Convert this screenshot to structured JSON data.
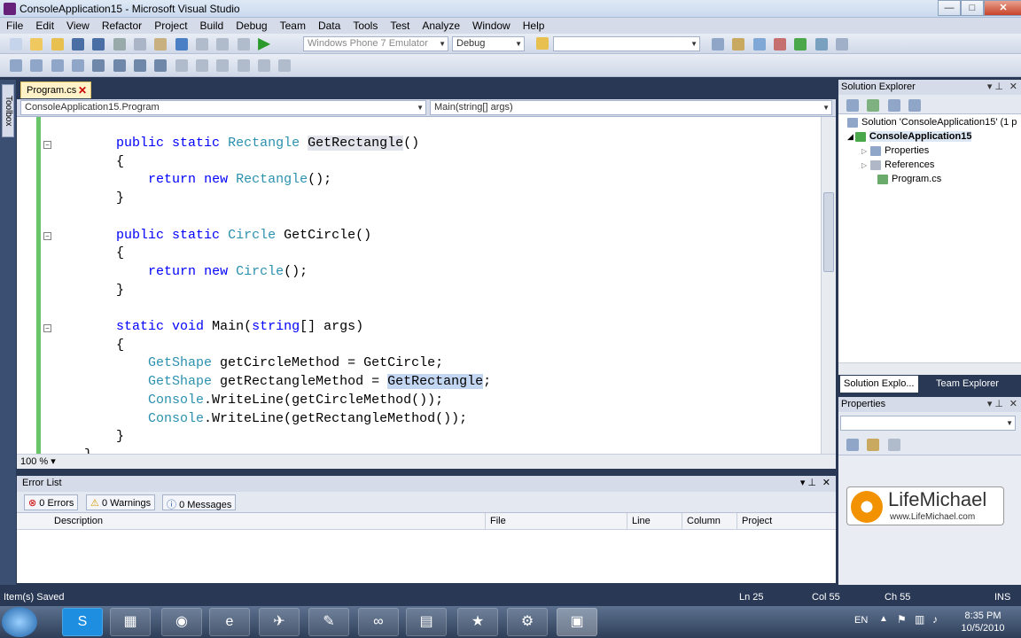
{
  "window": {
    "title": "ConsoleApplication15 - Microsoft Visual Studio",
    "minimize": "—",
    "maximize": "□",
    "close": "✕"
  },
  "menu": [
    "File",
    "Edit",
    "View",
    "Refactor",
    "Project",
    "Build",
    "Debug",
    "Team",
    "Data",
    "Tools",
    "Test",
    "Analyze",
    "Window",
    "Help"
  ],
  "toolbar": {
    "device": "Windows Phone 7 Emulator",
    "config": "Debug",
    "search": ""
  },
  "toolbox": {
    "label": "Toolbox"
  },
  "editor": {
    "tab": "Program.cs",
    "nav_left": "ConsoleApplication15.Program",
    "nav_right": "Main(string[] args)",
    "zoom": "100 %",
    "accent": "#6ac46a",
    "highlight": "#c3d7f3"
  },
  "error_list": {
    "title": "Error List",
    "errors": "0 Errors",
    "warnings": "0 Warnings",
    "messages": "0 Messages",
    "columns": [
      "Description",
      "File",
      "Line",
      "Column",
      "Project"
    ]
  },
  "status": {
    "left": "Item(s) Saved",
    "ln": "Ln 25",
    "col": "Col 55",
    "ch": "Ch 55",
    "ins": "INS"
  },
  "solution_explorer": {
    "title": "Solution Explorer",
    "items": [
      "Solution 'ConsoleApplication15' (1 p",
      "ConsoleApplication15",
      "Properties",
      "References",
      "Program.cs"
    ],
    "tabs": [
      "Solution Explo...",
      "Team Explorer"
    ]
  },
  "properties": {
    "title": "Properties"
  },
  "logo": {
    "name": "LifeMichael",
    "url": "www.LifeMichael.com"
  },
  "taskbar": {
    "lang": "EN",
    "time": "8:35 PM",
    "date": "10/5/2010"
  }
}
